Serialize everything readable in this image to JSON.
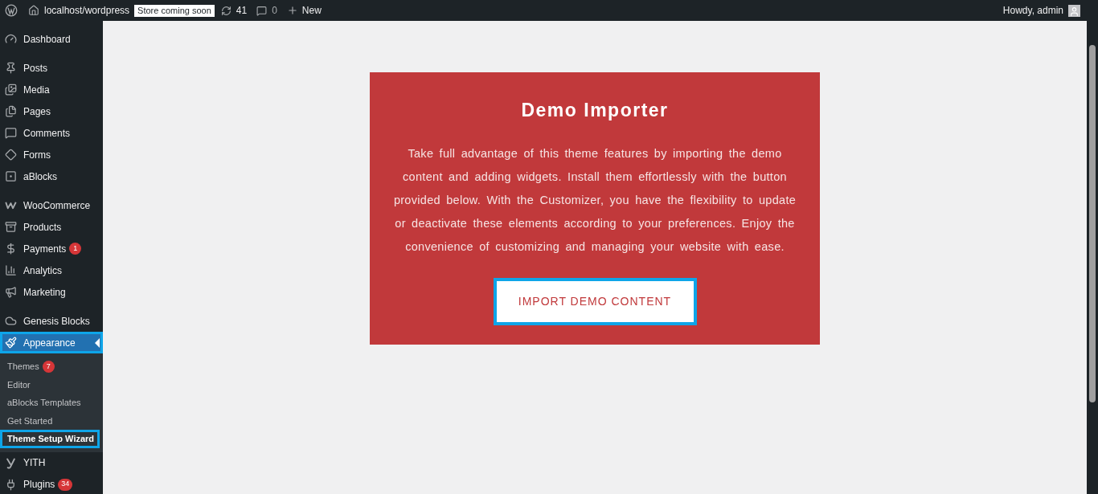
{
  "admin_bar": {
    "site": "localhost/wordpress",
    "store_badge": "Store coming soon",
    "updates": "41",
    "comments": "0",
    "new": "New",
    "greeting": "Howdy, admin"
  },
  "sidebar": {
    "groups": [
      [
        {
          "label": "Dashboard",
          "selected": false
        }
      ],
      [
        {
          "label": "Posts",
          "selected": false
        },
        {
          "label": "Media",
          "selected": false
        },
        {
          "label": "Pages",
          "selected": false
        },
        {
          "label": "Comments",
          "selected": false
        },
        {
          "label": "Forms",
          "selected": false
        },
        {
          "label": "aBlocks",
          "selected": false
        }
      ],
      [
        {
          "label": "WooCommerce",
          "selected": false
        },
        {
          "label": "Products",
          "selected": false
        },
        {
          "label": "Payments",
          "badge": "1",
          "selected": false
        },
        {
          "label": "Analytics",
          "selected": false
        },
        {
          "label": "Marketing",
          "selected": false
        }
      ],
      [
        {
          "label": "Genesis Blocks",
          "selected": false
        },
        {
          "label": "Appearance",
          "selected": true,
          "outlined": true,
          "children": [
            {
              "label": "Themes",
              "badge": "7",
              "selected": false,
              "outlined": false
            },
            {
              "label": "Editor",
              "selected": false,
              "outlined": false
            },
            {
              "label": "aBlocks Templates",
              "selected": false,
              "outlined": false
            },
            {
              "label": "Get Started",
              "selected": false,
              "outlined": false
            },
            {
              "label": "Theme Setup Wizard",
              "selected": true,
              "outlined": true
            }
          ]
        },
        {
          "label": "YITH",
          "selected": false
        },
        {
          "label": "Plugins",
          "badge": "34",
          "selected": false
        }
      ]
    ]
  },
  "card": {
    "title": "Demo Importer",
    "text": "Take full advantage of this theme features by importing the demo content and adding widgets. Install them effortlessly with the button provided below. With the Customizer, you have the flexibility to update or deactivate these elements according to your preferences. Enjoy the convenience of customizing and managing your website with ease.",
    "button": {
      "label": "IMPORT DEMO CONTENT",
      "outlined": true
    }
  }
}
